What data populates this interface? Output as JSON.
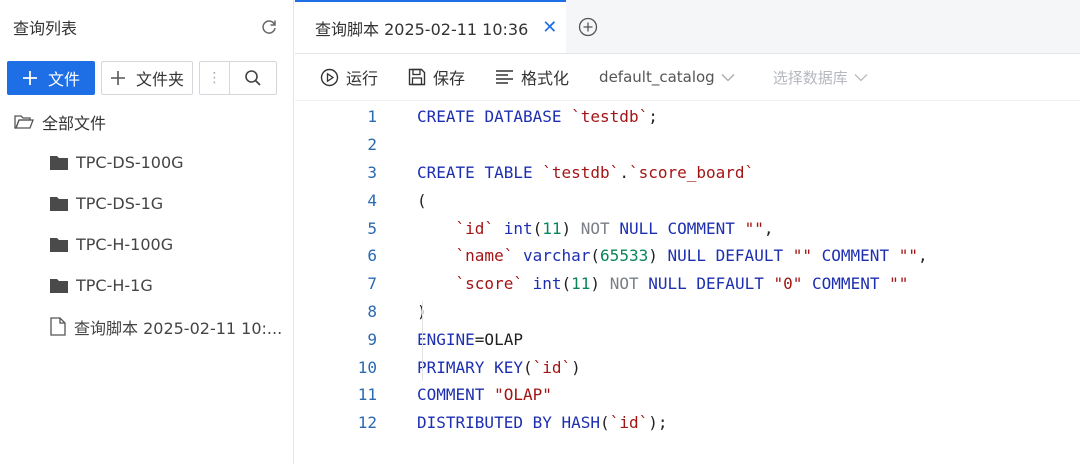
{
  "left_panel": {
    "title": "查询列表",
    "new_file_label": "文件",
    "new_folder_label": "文件夹",
    "more_label": "⋮",
    "tree_root": "全部文件",
    "tree_items": [
      {
        "label": "TPC-DS-100G",
        "icon": "folder-icon"
      },
      {
        "label": "TPC-DS-1G",
        "icon": "folder-icon"
      },
      {
        "label": "TPC-H-100G",
        "icon": "folder-icon"
      },
      {
        "label": "TPC-H-1G",
        "icon": "folder-icon"
      },
      {
        "label": "查询脚本 2025-02-11 10:...",
        "icon": "file-icon"
      }
    ]
  },
  "tabs": [
    {
      "label": "查询脚本 2025-02-11 10:36",
      "active": true
    }
  ],
  "toolbar": {
    "run_label": "运行",
    "save_label": "保存",
    "format_label": "格式化",
    "catalog_value": "default_catalog",
    "database_placeholder": "选择数据库"
  },
  "editor": {
    "line_numbers": [
      "1",
      "2",
      "3",
      "4",
      "5",
      "6",
      "7",
      "8",
      "9",
      "10",
      "11",
      "12"
    ],
    "lines": [
      "CREATE DATABASE `testdb`;",
      "",
      "CREATE TABLE `testdb`.`score_board`",
      "(",
      "    `id` int(11) NOT NULL COMMENT \"\",",
      "    `name` varchar(65533) NULL DEFAULT \"\" COMMENT \"\",",
      "    `score` int(11) NOT NULL DEFAULT \"0\" COMMENT \"\"",
      ")",
      "ENGINE=OLAP",
      "PRIMARY KEY(`id`)",
      "COMMENT \"OLAP\"",
      "DISTRIBUTED BY HASH(`id`);"
    ]
  },
  "colors": {
    "accent": "#1e6ee6",
    "keyword": "#1d2fb0",
    "string": "#a31515",
    "number": "#098658"
  }
}
